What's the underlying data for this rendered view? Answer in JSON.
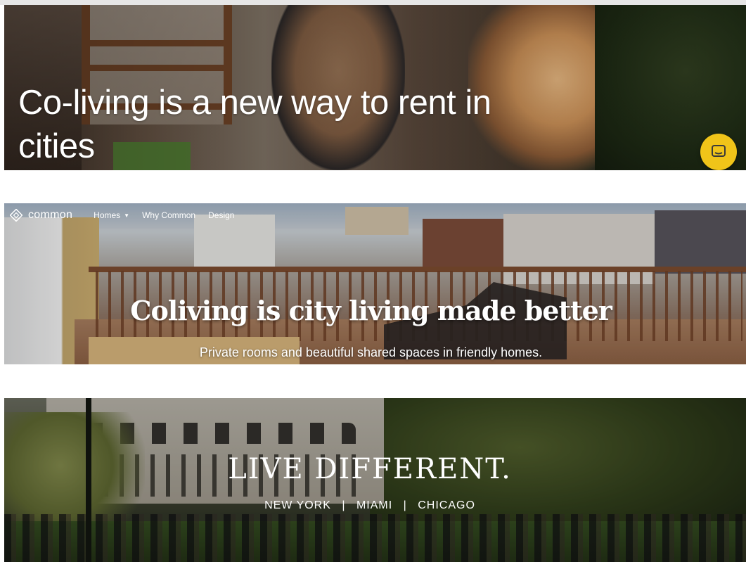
{
  "hero1": {
    "title": "Co-living is a new way to rent in cities",
    "chat_icon": "chat-bubble-icon",
    "chat_color": "#f0c419"
  },
  "hero2": {
    "nav": {
      "logo_icon": "diamond-logo-icon",
      "brand": "common",
      "links": [
        "Homes",
        "Why Common",
        "Design"
      ],
      "homes_caret_icon": "caret-down-icon"
    },
    "title": "Coliving is city living made better",
    "subtitle": "Private rooms and beautiful shared spaces in friendly homes."
  },
  "hero3": {
    "title": "LIVE DIFFERENT.",
    "cities": [
      "NEW YORK",
      "MIAMI",
      "CHICAGO"
    ],
    "separator": "|"
  }
}
